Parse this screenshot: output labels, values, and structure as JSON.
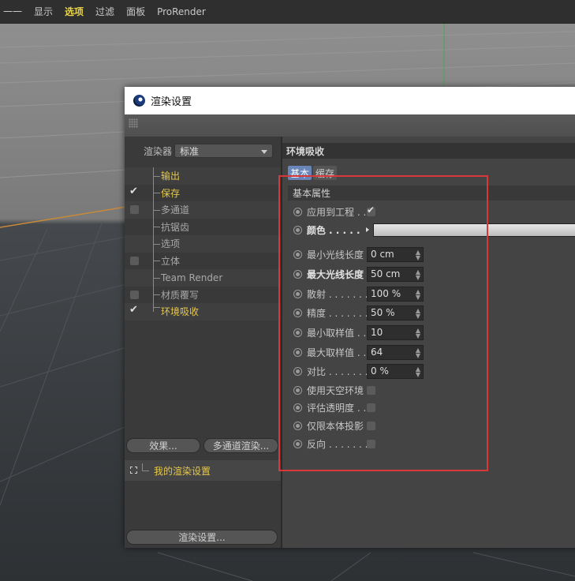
{
  "menubar": {
    "items": [
      "一一",
      "显示",
      "选项",
      "过滤",
      "面板",
      "ProRender"
    ],
    "active_index": 2
  },
  "dialog": {
    "title": "渲染设置"
  },
  "left": {
    "renderer_label": "渲染器",
    "renderer_value": "标准",
    "tree": [
      {
        "label": "输出",
        "checked": false,
        "has_check": false,
        "highlight": true
      },
      {
        "label": "保存",
        "checked": true,
        "has_check": true,
        "highlight": true
      },
      {
        "label": "多通道",
        "checked": false,
        "has_check": true,
        "highlight": false
      },
      {
        "label": "抗锯齿",
        "checked": false,
        "has_check": false,
        "highlight": false
      },
      {
        "label": "选项",
        "checked": false,
        "has_check": false,
        "highlight": false
      },
      {
        "label": "立体",
        "checked": false,
        "has_check": true,
        "highlight": false
      },
      {
        "label": "Team Render",
        "checked": false,
        "has_check": false,
        "highlight": false
      },
      {
        "label": "材质覆写",
        "checked": false,
        "has_check": true,
        "highlight": false
      },
      {
        "label": "环境吸收",
        "checked": true,
        "has_check": true,
        "highlight": true
      }
    ],
    "effects_button": "效果...",
    "multipass_button": "多通道渲染...",
    "preset_label": "我的渲染设置",
    "render_settings_button": "渲染设置..."
  },
  "right": {
    "section_title": "环境吸收",
    "tabs": [
      {
        "label": "基本",
        "active": true
      },
      {
        "label": "缓存",
        "active": false
      }
    ],
    "group_title": "基本属性",
    "params": [
      {
        "label": "应用到工程 . .",
        "type": "checkbox",
        "checked": true,
        "bold": false
      },
      {
        "label": "颜色 . . . . .",
        "type": "color",
        "bold": true
      },
      {
        "label": "最小光线长度",
        "type": "number",
        "value": "0 cm",
        "bold": false
      },
      {
        "label": "最大光线长度",
        "type": "number",
        "value": "50 cm",
        "bold": true
      },
      {
        "label": "散射 . . . . . . .",
        "type": "number",
        "value": "100 %",
        "bold": false
      },
      {
        "label": "精度 . . . . . . .",
        "type": "number",
        "value": "50 %",
        "bold": false
      },
      {
        "label": "最小取样值 . .",
        "type": "number",
        "value": "10",
        "bold": false
      },
      {
        "label": "最大取样值 . .",
        "type": "number",
        "value": "64",
        "bold": false
      },
      {
        "label": "对比 . . . . . . .",
        "type": "number",
        "value": "0 %",
        "bold": false
      },
      {
        "label": "使用天空环境",
        "type": "checkbox",
        "checked": false,
        "bold": false
      },
      {
        "label": "评估透明度 . .",
        "type": "checkbox",
        "checked": false,
        "bold": false
      },
      {
        "label": "仅限本体投影",
        "type": "checkbox",
        "checked": false,
        "bold": false
      },
      {
        "label": "反向 . . . . . . .",
        "type": "checkbox",
        "checked": false,
        "bold": false
      }
    ]
  },
  "colors": {
    "active_menu": "#e8d34a",
    "highlight_label": "#e5c84b",
    "active_tab": "#6a86b8",
    "annotation_box": "#d8383a"
  }
}
